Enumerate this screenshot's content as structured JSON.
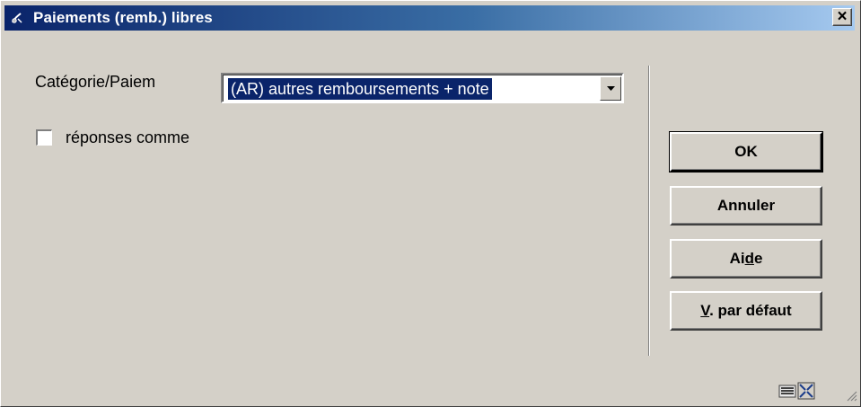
{
  "window": {
    "title": "Paiements (remb.) libres",
    "close_label": "×",
    "colors": {
      "title_bar_start": "#0a246a",
      "title_bar_end": "#a6caf0",
      "face": "#d4d0c8",
      "selection": "#0a246a"
    }
  },
  "form": {
    "category_label": "Catégorie/Paiem",
    "category_value": "(AR) autres remboursements + note",
    "checkbox_label": "réponses comme",
    "checkbox_checked": false
  },
  "buttons": {
    "ok": "OK",
    "cancel": "Annuler",
    "help_pre": "Ai",
    "help_mnemonic": "d",
    "help_post": "e",
    "defaults_mnemonic": "V",
    "defaults_rest": ". par défaut"
  },
  "status_icons": [
    "keyboard-icon",
    "resize-icon",
    "size-grip-icon"
  ]
}
